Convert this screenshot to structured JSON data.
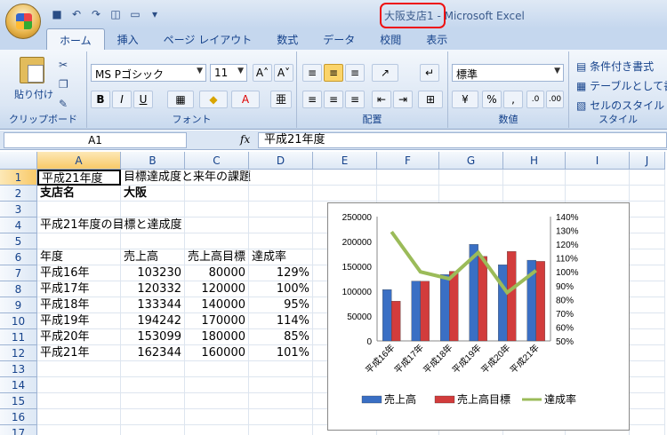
{
  "window": {
    "title": "大阪支店1 - Microsoft Excel",
    "title_highlight": "大阪支店1"
  },
  "tabs": [
    "ホーム",
    "挿入",
    "ページ レイアウト",
    "数式",
    "データ",
    "校閲",
    "表示"
  ],
  "ribbon": {
    "clipboard": {
      "paste_label": "貼り付け",
      "group_label": "クリップボード"
    },
    "font": {
      "font_name": "MS Pゴシック",
      "font_size": "11",
      "group_label": "フォント"
    },
    "alignment": {
      "group_label": "配置"
    },
    "number": {
      "format": "標準",
      "group_label": "数値",
      "percent": "%",
      "comma": ","
    },
    "styles": {
      "items": [
        "条件付き書式",
        "テーブルとして書式",
        "セルのスタイル"
      ],
      "group_label": "スタイル"
    }
  },
  "formula_bar": {
    "name_box": "A1",
    "fx": "fx",
    "content": "平成21年度"
  },
  "columns": [
    "A",
    "B",
    "C",
    "D",
    "E",
    "F",
    "G",
    "H",
    "I",
    "J"
  ],
  "rows": [
    "1",
    "2",
    "3",
    "4",
    "5",
    "6",
    "7",
    "8",
    "9",
    "10",
    "11",
    "12",
    "13",
    "14",
    "15",
    "16",
    "17"
  ],
  "cells": {
    "A1": "平成21年度",
    "B1": "目標達成度と来年の課題",
    "A2": "支店名",
    "B2": "大阪",
    "A4": "平成21年度の目標と達成度",
    "A6": "年度",
    "B6": "売上高",
    "C6": "売上高目標",
    "D6": "達成率",
    "A7": "平成16年",
    "B7": "103230",
    "C7": "80000",
    "D7": "129%",
    "A8": "平成17年",
    "B8": "120332",
    "C8": "120000",
    "D8": "100%",
    "A9": "平成18年",
    "B9": "133344",
    "C9": "140000",
    "D9": "95%",
    "A10": "平成19年",
    "B10": "194242",
    "C10": "170000",
    "D10": "114%",
    "A11": "平成20年",
    "B11": "153099",
    "C11": "180000",
    "D11": "85%",
    "A12": "平成21年",
    "B12": "162344",
    "C12": "160000",
    "D12": "101%"
  },
  "chart_data": {
    "type": "bar",
    "categories": [
      "平成16年",
      "平成17年",
      "平成18年",
      "平成19年",
      "平成20年",
      "平成21年"
    ],
    "series": [
      {
        "name": "売上高",
        "kind": "bar",
        "axis": "left",
        "color": "#3a6fc4",
        "values": [
          103230,
          120332,
          133344,
          194242,
          153099,
          162344
        ]
      },
      {
        "name": "売上高目標",
        "kind": "bar",
        "axis": "left",
        "color": "#d23c3c",
        "values": [
          80000,
          120000,
          140000,
          170000,
          180000,
          160000
        ]
      },
      {
        "name": "達成率",
        "kind": "line",
        "axis": "right",
        "color": "#9bbb59",
        "values": [
          1.29,
          1.0,
          0.95,
          1.14,
          0.85,
          1.01
        ]
      }
    ],
    "ylim": [
      0,
      250000
    ],
    "yticks": [
      "0",
      "50000",
      "100000",
      "150000",
      "200000",
      "250000"
    ],
    "y2lim": [
      0.5,
      1.4
    ],
    "y2ticks": [
      "50%",
      "60%",
      "70%",
      "80%",
      "90%",
      "100%",
      "110%",
      "120%",
      "130%",
      "140%"
    ],
    "legend": "bottom"
  }
}
